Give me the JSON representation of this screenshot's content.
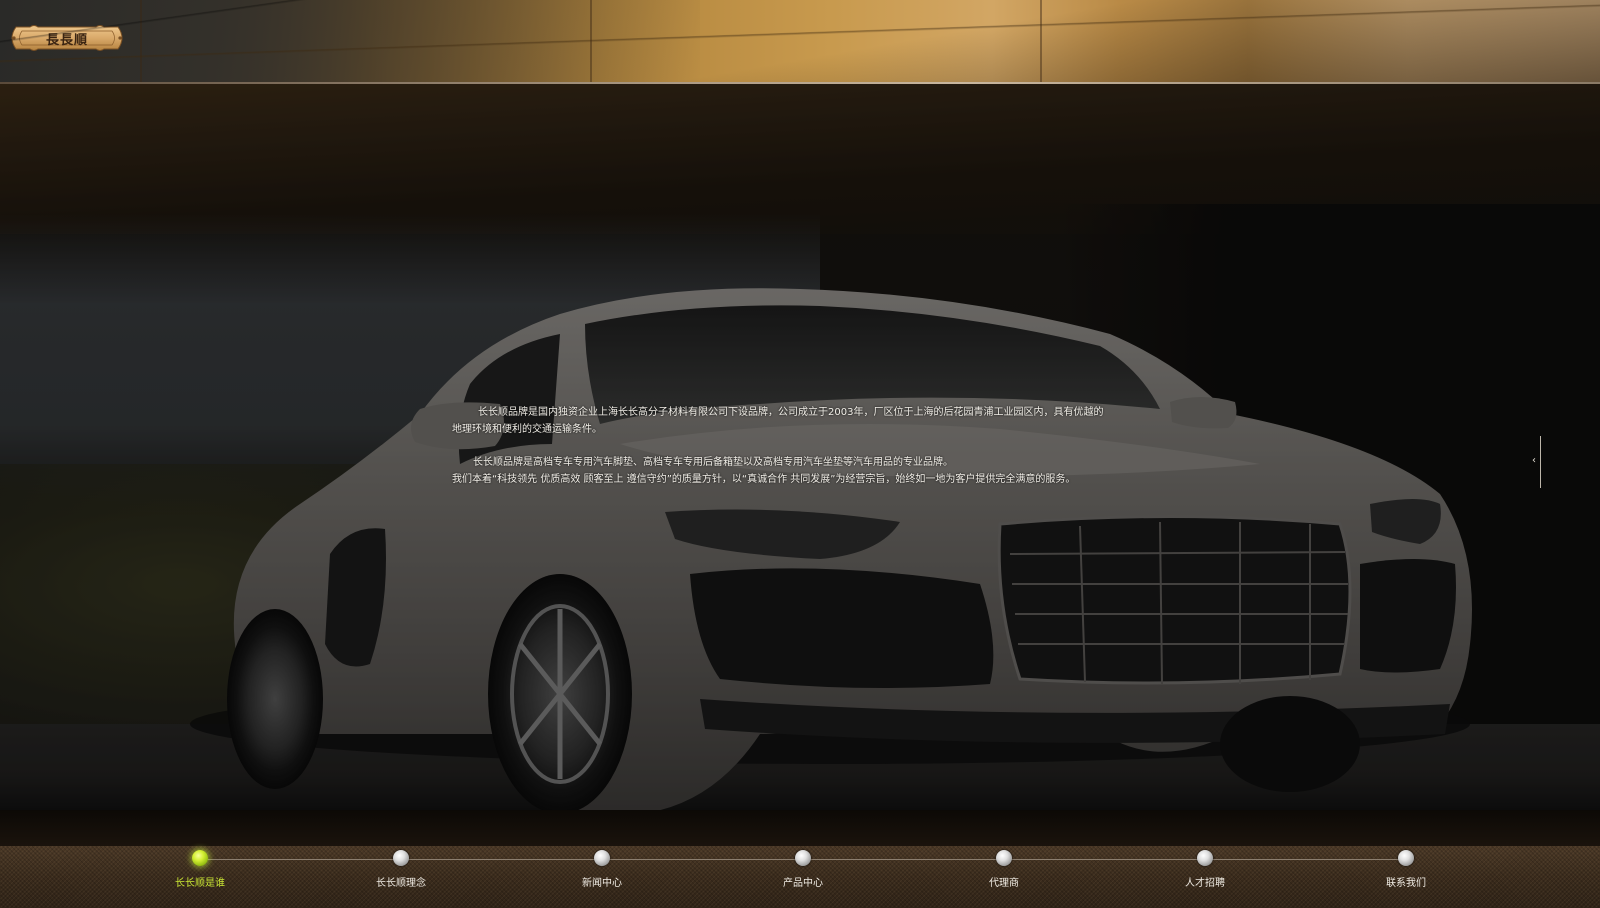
{
  "header": {
    "logo_text": "長長順"
  },
  "intro": {
    "paragraph_1": "长长顺品牌是国内独资企业上海长长高分子材料有限公司下设品牌，公司成立于2003年，厂区位于上海的后花园青浦工业园区内，具有优越的地理环境和便利的交通运输条件。",
    "paragraph_2_line_1": "长长顺品牌是高档专车专用汽车脚垫、高档专车专用后备箱垫以及高档专用汽车坐垫等汽车用品的专业品牌。",
    "paragraph_2_line_2": "我们本着“科技领先  优质高效  顾客至上  遵信守约”的质量方针，以“真诚合作  共同发展”为经营宗旨，始终如一地为客户提供完全满意的服务。"
  },
  "side_handle": {
    "icon": "chevron-left-icon",
    "glyph": "‹"
  },
  "nav": {
    "items": [
      {
        "label": "长长顺是谁",
        "active": true
      },
      {
        "label": "长长顺理念",
        "active": false
      },
      {
        "label": "新闻中心",
        "active": false
      },
      {
        "label": "产品中心",
        "active": false
      },
      {
        "label": "代理商",
        "active": false
      },
      {
        "label": "人才招聘",
        "active": false
      },
      {
        "label": "联系我们",
        "active": false
      }
    ]
  },
  "colors": {
    "active_nav": "#c9e534",
    "nav_text": "#f0ece4",
    "footer_bg": "#3a2c1e",
    "logo_badge": "#d9a96a"
  }
}
